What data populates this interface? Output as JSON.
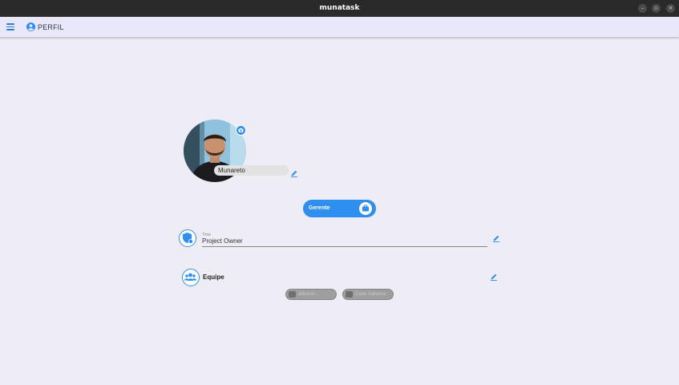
{
  "window": {
    "title": "munatask"
  },
  "appbar": {
    "title": "PERFIL"
  },
  "profile": {
    "name": "Munareto"
  },
  "role": {
    "label": "Gerente"
  },
  "time": {
    "label": "Time",
    "value": "Project Owner"
  },
  "team": {
    "title": "Equipe",
    "members": [
      {
        "name": "allenzer..."
      },
      {
        "name": "Cadu Valiense"
      }
    ]
  },
  "colors": {
    "accent": "#2e8ff0",
    "background": "#eeedf6",
    "appbar": "#e9e8fb"
  }
}
